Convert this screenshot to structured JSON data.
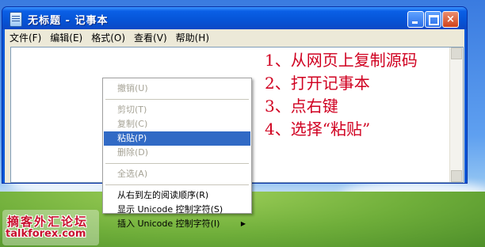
{
  "window": {
    "title": "无标题 - 记事本",
    "controls": {
      "minimize": "minimize-icon",
      "maximize": "maximize-icon",
      "close": "×"
    }
  },
  "menubar": [
    "文件(F)",
    "编辑(E)",
    "格式(O)",
    "查看(V)",
    "帮助(H)"
  ],
  "instructions": [
    "1、从网页上复制源码",
    "2、打开记事本",
    "3、点右键",
    "4、选择“粘贴”"
  ],
  "context_menu": {
    "items": [
      {
        "label": "撤销(U)",
        "enabled": false
      },
      {
        "label": "剪切(T)",
        "enabled": false
      },
      {
        "label": "复制(C)",
        "enabled": false
      },
      {
        "label": "粘贴(P)",
        "enabled": true,
        "highlighted": true
      },
      {
        "label": "删除(D)",
        "enabled": false
      },
      {
        "label": "全选(A)",
        "enabled": false
      },
      {
        "label": "从右到左的阅读顺序(R)",
        "enabled": true
      },
      {
        "label": "显示 Unicode 控制字符(S)",
        "enabled": true
      },
      {
        "label": "插入 Unicode 控制字符(I)",
        "enabled": true,
        "submenu": "▶"
      }
    ]
  },
  "watermark": {
    "cn": "摘客外汇论坛",
    "en": "talkforex.com"
  },
  "colors": {
    "titlebar": "#0654d6",
    "highlight": "#316ac5",
    "instruction_text": "#d00020"
  }
}
